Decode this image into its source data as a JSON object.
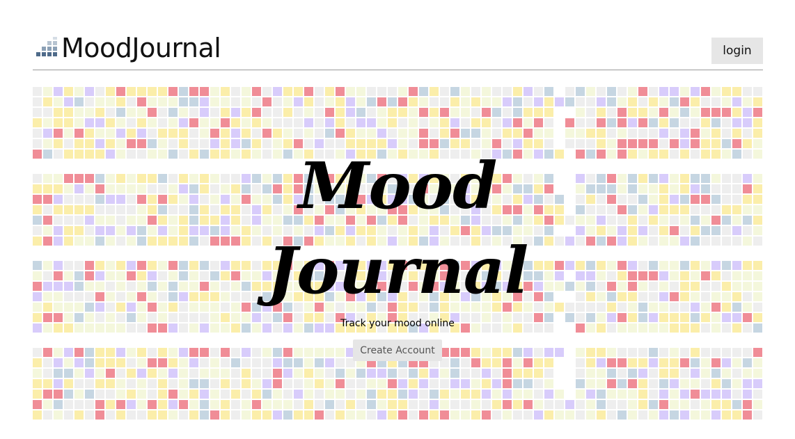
{
  "header": {
    "app_name": "MoodJournal",
    "login_label": "login"
  },
  "hero": {
    "title_line1": "Mood",
    "title_line2": "Journal",
    "tagline": "Track your mood online",
    "cta_label": "Create Account"
  },
  "colors": {
    "mood_red": "#f08d97",
    "mood_yellow": "#fbeeaa",
    "mood_cream": "#f4f7dc",
    "mood_blue": "#c6d6e2",
    "mood_purple": "#d8ccfb",
    "mood_gray": "#eeeeee",
    "logo_blue": "#4f6b8a"
  }
}
